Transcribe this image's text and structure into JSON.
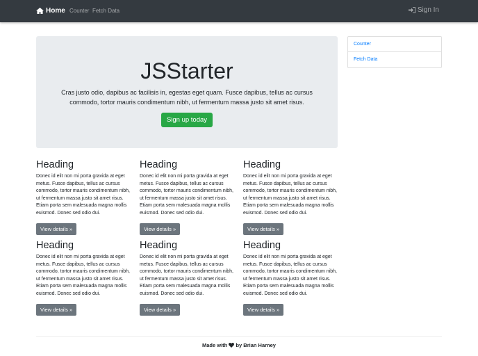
{
  "nav": {
    "brand": "Home",
    "links": [
      "Counter",
      "Fetch Data"
    ],
    "signin": "Sign In"
  },
  "jumbotron": {
    "title": "JSStarter",
    "text": "Cras justo odio, dapibus ac facilisis in, egestas eget quam. Fusce dapibus, tellus ac cursus commodo, tortor mauris condimentum nibh, ut fermentum massa justo sit amet risus.",
    "button": "Sign up today"
  },
  "sidebar": {
    "items": [
      "Counter",
      "Fetch Data"
    ]
  },
  "cards": [
    {
      "heading": "Heading",
      "text": "Donec id elit non mi porta gravida at eget metus. Fusce dapibus, tellus ac cursus commodo, tortor mauris condimentum nibh, ut fermentum massa justo sit amet risus. Etiam porta sem malesuada magna mollis euismod. Donec sed odio dui.",
      "button": "View details »"
    },
    {
      "heading": "Heading",
      "text": "Donec id elit non mi porta gravida at eget metus. Fusce dapibus, tellus ac cursus commodo, tortor mauris condimentum nibh, ut fermentum massa justo sit amet risus. Etiam porta sem malesuada magna mollis euismod. Donec sed odio dui.",
      "button": "View details »"
    },
    {
      "heading": "Heading",
      "text": "Donec id elit non mi porta gravida at eget metus. Fusce dapibus, tellus ac cursus commodo, tortor mauris condimentum nibh, ut fermentum massa justo sit amet risus. Etiam porta sem malesuada magna mollis euismod. Donec sed odio dui.",
      "button": "View details »"
    },
    {
      "heading": "Heading",
      "text": "Donec id elit non mi porta gravida at eget metus. Fusce dapibus, tellus ac cursus commodo, tortor mauris condimentum nibh, ut fermentum massa justo sit amet risus. Etiam porta sem malesuada magna mollis euismod. Donec sed odio dui.",
      "button": "View details »"
    },
    {
      "heading": "Heading",
      "text": "Donec id elit non mi porta gravida at eget metus. Fusce dapibus, tellus ac cursus commodo, tortor mauris condimentum nibh, ut fermentum massa justo sit amet risus. Etiam porta sem malesuada magna mollis euismod. Donec sed odio dui.",
      "button": "View details »"
    },
    {
      "heading": "Heading",
      "text": "Donec id elit non mi porta gravida at eget metus. Fusce dapibus, tellus ac cursus commodo, tortor mauris condimentum nibh, ut fermentum massa justo sit amet risus. Etiam porta sem malesuada magna mollis euismod. Donec sed odio dui.",
      "button": "View details »"
    }
  ],
  "footer": {
    "prefix": "Made with",
    "suffix": "by Brian Harney"
  }
}
